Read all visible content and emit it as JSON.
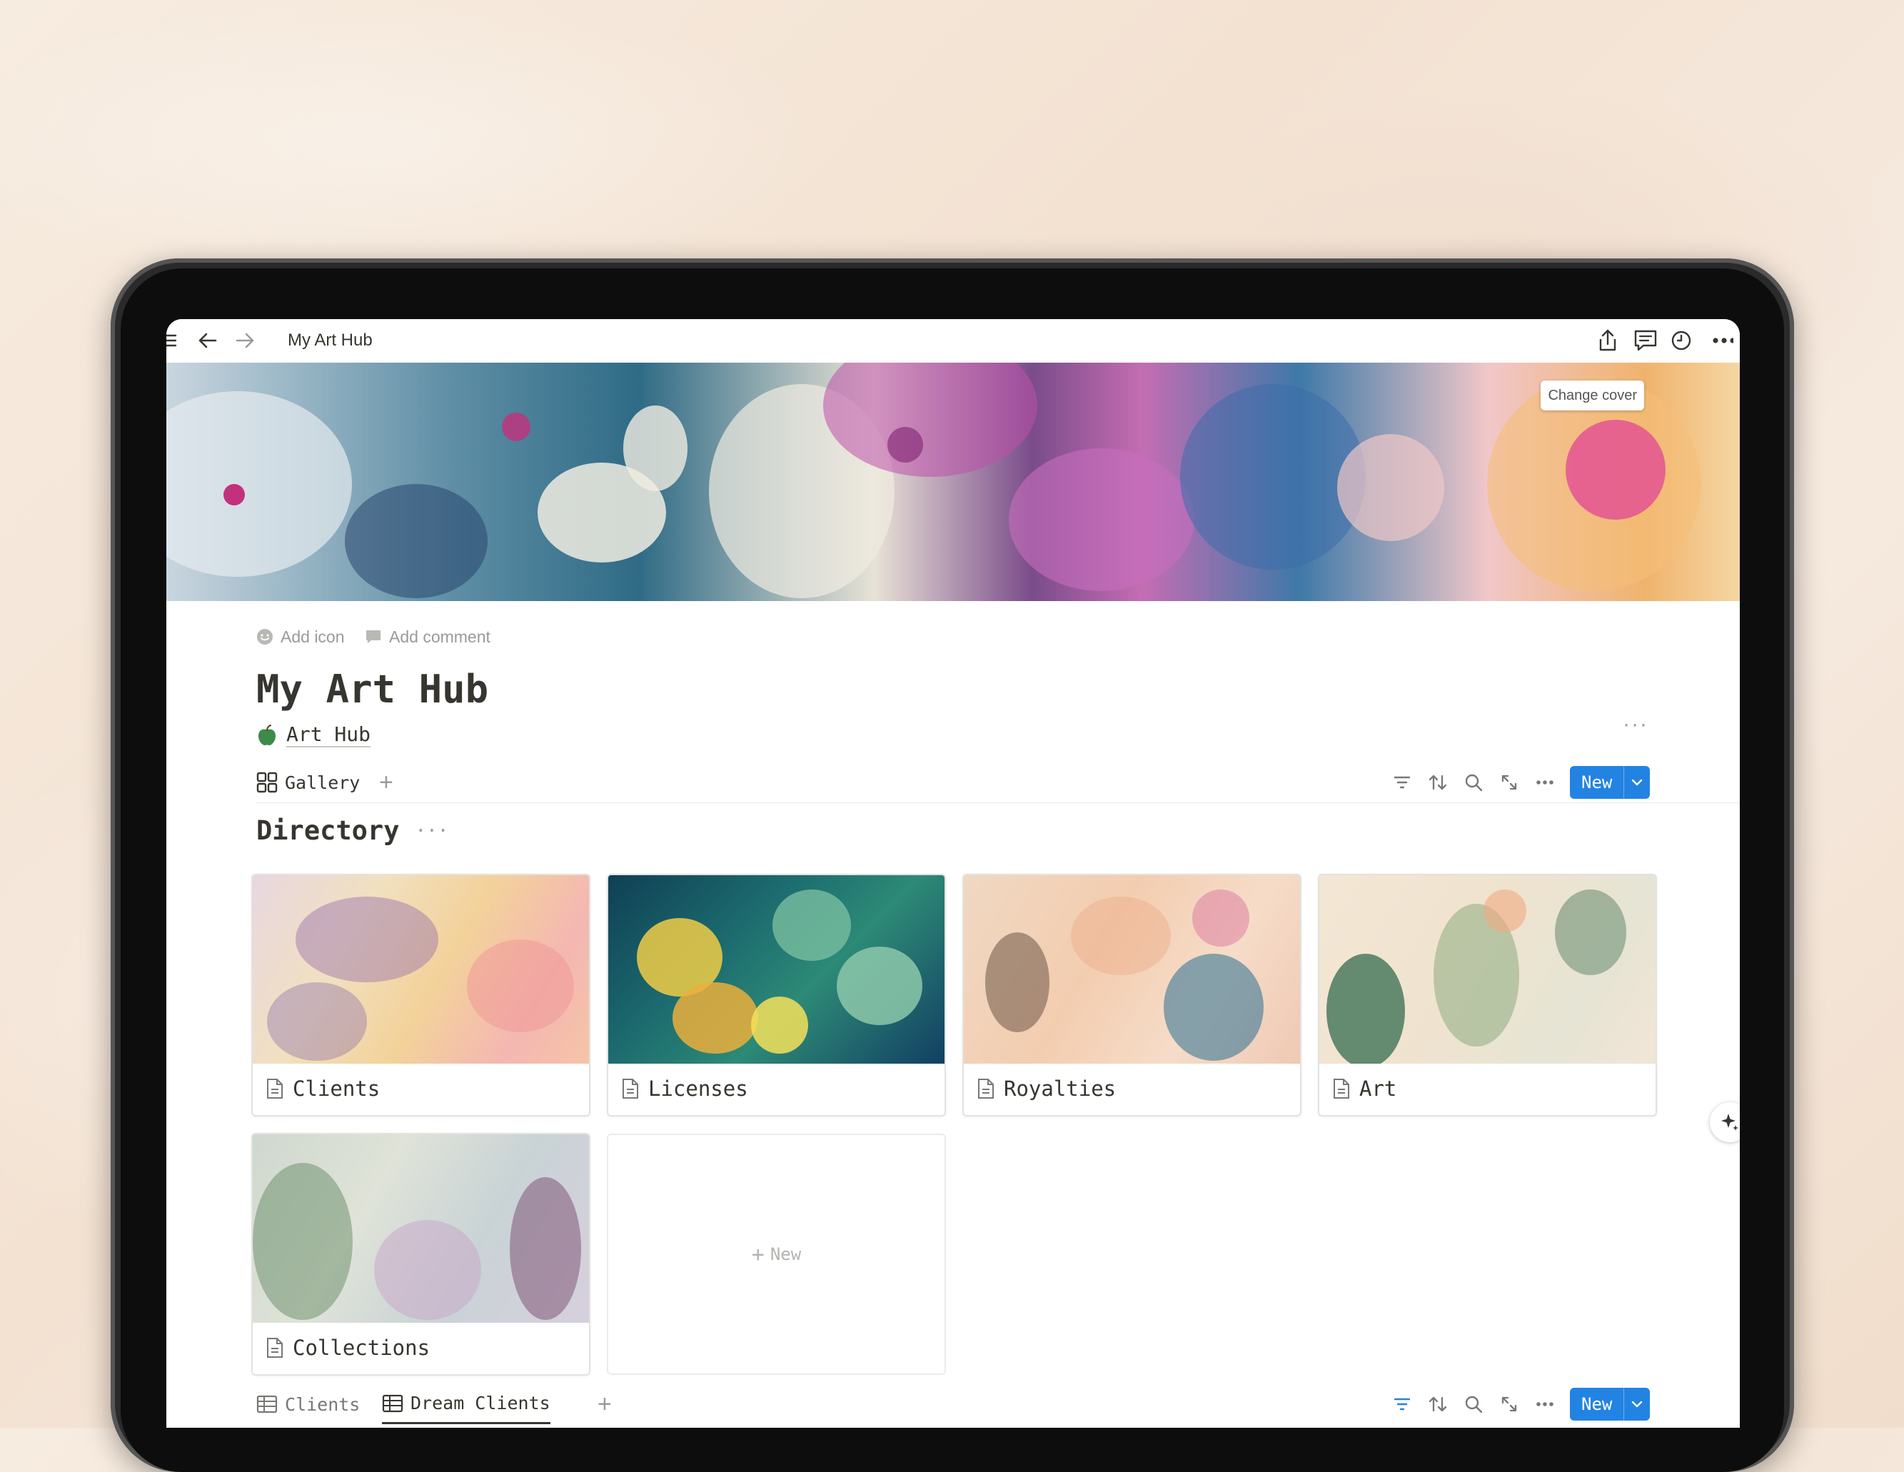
{
  "topbar": {
    "breadcrumb": "My Art Hub",
    "icons": [
      "menu-icon",
      "back-arrow-icon",
      "forward-arrow-icon",
      "share-icon",
      "comments-icon",
      "updates-clock-icon",
      "more-icon"
    ]
  },
  "cover": {
    "change_cover_label": "Change cover"
  },
  "page": {
    "add_icon_label": "Add icon",
    "add_comment_label": "Add comment",
    "title": "My Art Hub",
    "relation_label": "Art Hub",
    "relation_icon": "green-apple-icon"
  },
  "view1": {
    "tab_label": "Gallery",
    "new_label": "New"
  },
  "directory": {
    "heading": "Directory",
    "cards": [
      {
        "label": "Clients"
      },
      {
        "label": "Licenses"
      },
      {
        "label": "Royalties"
      },
      {
        "label": "Art"
      },
      {
        "label": "Collections"
      }
    ],
    "new_card_label": "New"
  },
  "view2": {
    "tabs": [
      {
        "label": "Clients"
      },
      {
        "label": "Dream Clients"
      }
    ],
    "new_label": "New"
  },
  "colors": {
    "accent": "#2383e2",
    "text": "#37352f",
    "muted": "#9b9a97"
  }
}
